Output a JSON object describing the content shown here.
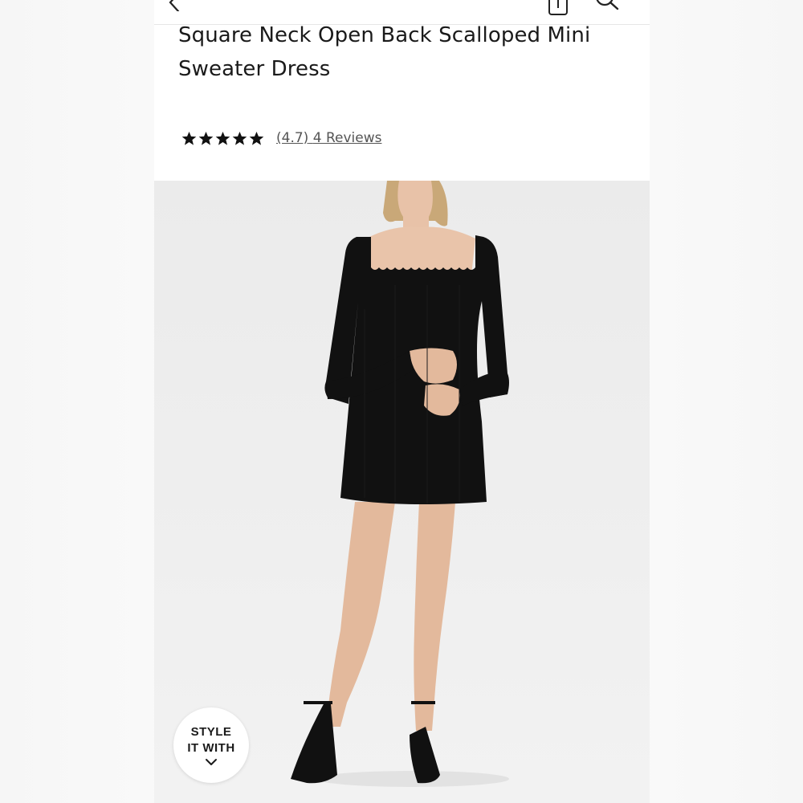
{
  "product": {
    "title": "Square Neck Open Back Scalloped Mini Sweater Dress",
    "rating_stars": 5,
    "rating_value": "(4.7)",
    "reviews_text": "4 Reviews"
  },
  "header": {
    "icons": [
      "back-arrow-icon",
      "share-icon",
      "search-icon"
    ]
  },
  "image": {
    "description_icon": "product-photo"
  },
  "style_button": {
    "line1": "STYLE",
    "line2": "IT WITH",
    "icon": "chevron-down-icon"
  },
  "colors": {
    "text": "#1a1a1a",
    "link": "#555555",
    "dress": "#111111",
    "background": "#ececec"
  }
}
